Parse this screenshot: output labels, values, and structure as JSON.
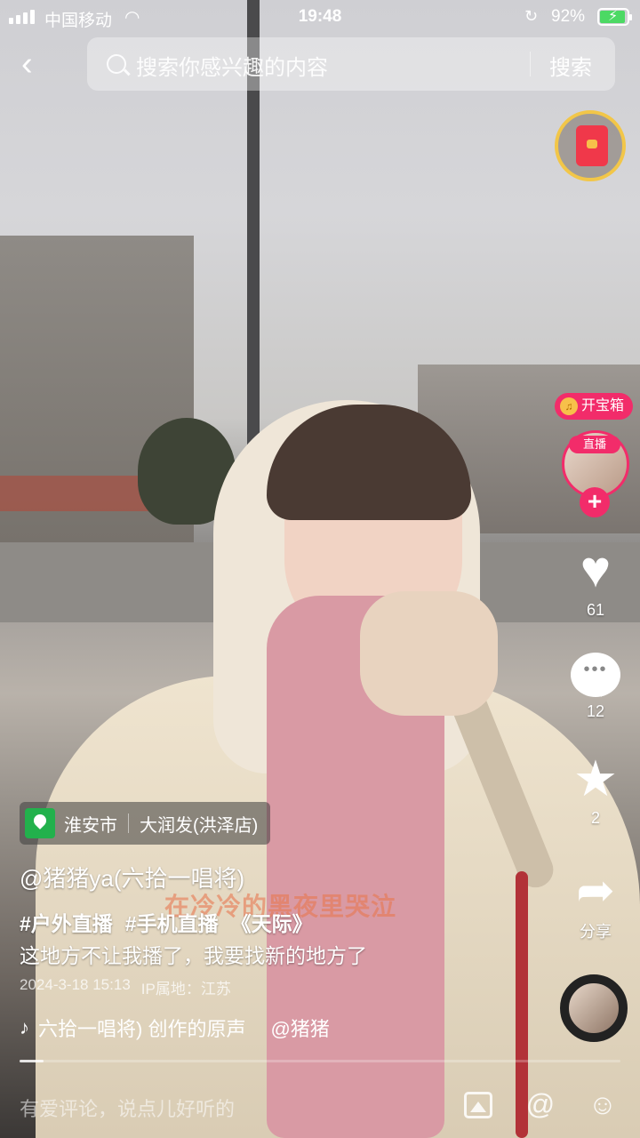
{
  "status_bar": {
    "carrier": "中国移动",
    "time": "19:48",
    "battery_pct": "92%",
    "battery_level": 0.92,
    "icons": [
      "signal-icon",
      "wifi-icon",
      "rotation-lock-icon",
      "battery-charging-icon"
    ]
  },
  "search": {
    "placeholder": "搜索你感兴趣的内容",
    "button": "搜索"
  },
  "rail": {
    "treasure_label": "开宝箱",
    "live_label": "直播",
    "likes": "61",
    "comments": "12",
    "favorites": "2",
    "share_label": "分享"
  },
  "video": {
    "location_city": "淮安市",
    "location_place": "大润发(洪泽店)",
    "author": "@猪猪ya(六拾一唱将)",
    "tags": [
      "#户外直播",
      "#手机直播",
      "《天际》"
    ],
    "description": "这地方不让我播了，我要找新的地方了",
    "date": "2024-3-18 15:13",
    "ip_location": "IP属地：江苏",
    "music": "六拾一唱将) 创作的原声",
    "music_author": "@猪猪",
    "overlay_lyric": "在冷冷的黑夜里哭泣",
    "progress": 0.04
  },
  "comment_bar": {
    "placeholder": "有爱评论，说点儿好听的"
  },
  "colors": {
    "accent_pink": "#f22c6a",
    "location_green": "#22b14c",
    "redpacket_red": "#f0384a",
    "redpacket_ring": "#f2c648"
  }
}
